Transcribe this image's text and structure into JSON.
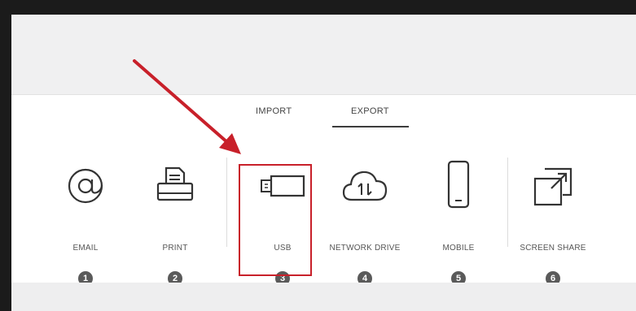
{
  "tabs": [
    {
      "label": "IMPORT",
      "active": false
    },
    {
      "label": "EXPORT",
      "active": true
    }
  ],
  "export_options": [
    {
      "label": "EMAIL",
      "number": "1",
      "icon": "at-sign-icon"
    },
    {
      "label": "PRINT",
      "number": "2",
      "icon": "printer-icon"
    },
    {
      "label": "USB",
      "number": "3",
      "icon": "usb-drive-icon",
      "highlighted": true
    },
    {
      "label": "NETWORK DRIVE",
      "number": "4",
      "icon": "cloud-sync-icon"
    },
    {
      "label": "MOBILE",
      "number": "5",
      "icon": "mobile-phone-icon"
    },
    {
      "label": "SCREEN SHARE",
      "number": "6",
      "icon": "screen-share-icon"
    }
  ],
  "annotation": {
    "arrow_color": "#c8202a",
    "highlight_color": "#c8202a"
  },
  "colors": {
    "badge": "#5a5a5a",
    "tab_underline": "#3c3c3c"
  }
}
